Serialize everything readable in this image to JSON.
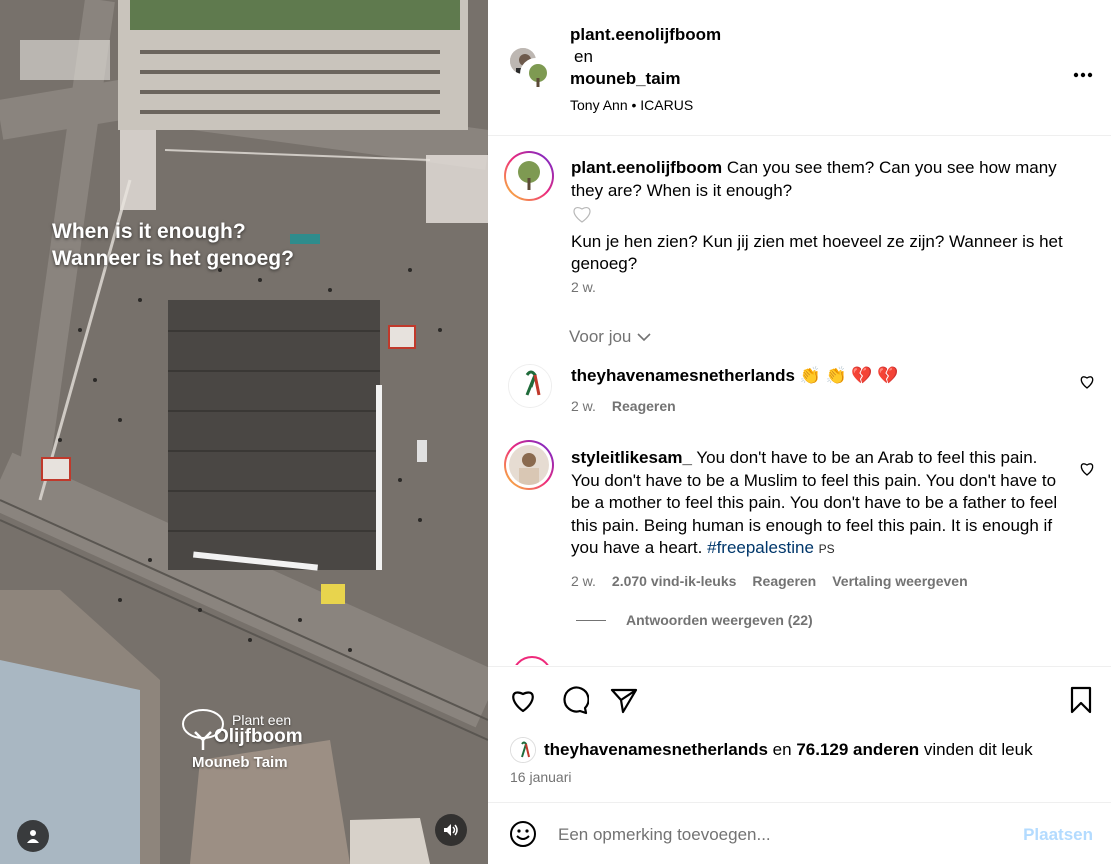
{
  "media": {
    "overlay_line1": "When is it enough?",
    "overlay_line2": "Wanneer is het genoeg?",
    "watermark_top": "Plant een",
    "watermark_main": "Olijfboom",
    "watermark_sub": "Mouneb Taim",
    "profile_icon": "person-icon",
    "volume_icon": "speaker-icon"
  },
  "header": {
    "user1": "plant.eenolijfboom",
    "conjunction": "en",
    "user2": "mouneb_taim",
    "audio": "Tony Ann • ICARUS",
    "more_icon": "more-horizontal-icon"
  },
  "caption": {
    "username": "plant.eenolijfboom",
    "text_en": "Can you see them? Can you see how many they are? When is it enough?",
    "text_nl": "Kun je hen zien? Kun jij zien met hoeveel ze zijn? Wanneer is het genoeg?",
    "time": "2 w."
  },
  "voor_jou": "Voor jou",
  "comments": [
    {
      "username": "theyhavenamesnetherlands",
      "text": "👏 👏 💔 💔",
      "time": "2 w.",
      "reply": "Reageren"
    },
    {
      "username": "styleitlikesam_",
      "text": "You don't have to be an Arab to feel this pain. You don't have to be a Muslim to feel this pain. You don't have to be a mother to feel this pain. You don't have to be a father to feel this pain. Being human is enough to feel this pain. It is enough if you have a heart.",
      "hashtag": "#freepalestine",
      "suffix": "PS",
      "time": "2 w.",
      "likes": "2.070 vind-ik-leuks",
      "reply": "Reageren",
      "translate": "Vertaling weergeven",
      "view_replies": "Antwoorden weergeven (22)"
    }
  ],
  "actions": {
    "liked_by_user": "theyhavenamesnetherlands",
    "liked_middle": "en",
    "liked_count": "76.129 anderen",
    "liked_suffix": "vinden dit leuk",
    "date": "16 januari"
  },
  "add_comment": {
    "placeholder": "Een opmerking toevoegen...",
    "post": "Plaatsen"
  },
  "colors": {
    "muted": "#737373",
    "post_disabled": "#b3dbff",
    "hashtag": "#00376b"
  }
}
